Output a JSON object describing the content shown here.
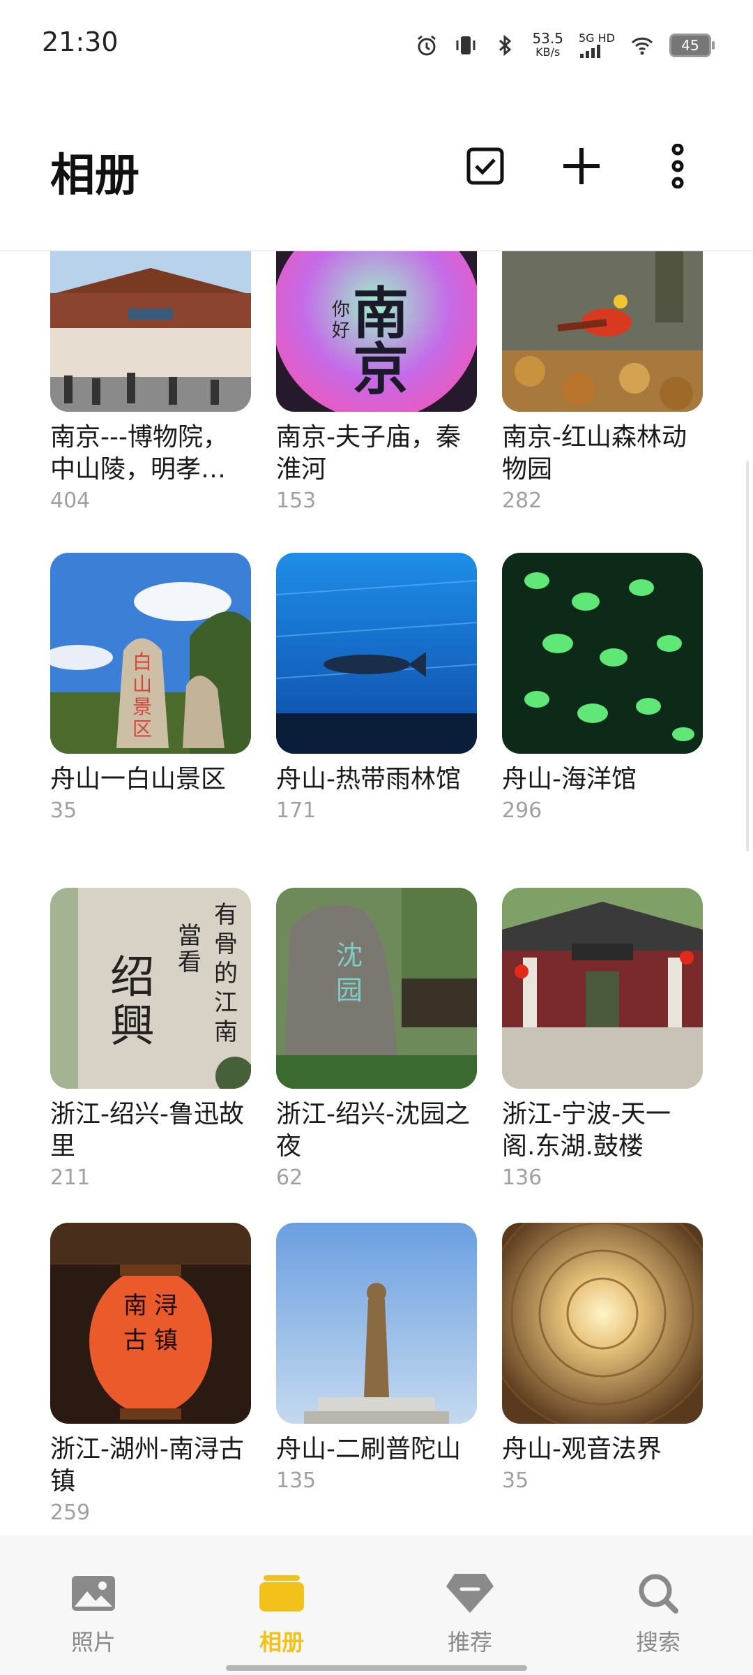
{
  "status_bar": {
    "time": "21:30",
    "net_speed_value": "53.5",
    "net_speed_unit": "KB/s",
    "network_label": "5G HD",
    "battery_level": "45",
    "icons": [
      "alarm-icon",
      "vibrate-icon",
      "bluetooth-icon",
      "signal-icon",
      "wifi-icon",
      "battery-icon"
    ]
  },
  "header": {
    "title": "相册",
    "actions": [
      "select-icon",
      "add-icon",
      "more-icon"
    ]
  },
  "albums": [
    {
      "name": "南京---博物院，中山陵，明孝…",
      "count": "404"
    },
    {
      "name": "南京-夫子庙，秦淮河",
      "count": "153",
      "thumb_text": [
        "你",
        "好",
        "南",
        "京"
      ]
    },
    {
      "name": "南京-红山森林动物园",
      "count": "282"
    },
    {
      "name": "舟山一白山景区",
      "count": "35",
      "thumb_text": [
        "白",
        "山",
        "景",
        "区"
      ]
    },
    {
      "name": "舟山-热带雨林馆",
      "count": "171"
    },
    {
      "name": "舟山-海洋馆",
      "count": "296"
    },
    {
      "name": "浙江-绍兴-鲁迅故里",
      "count": "211",
      "thumb_text": [
        "绍",
        "興",
        "當",
        "看",
        "有",
        "骨",
        "的",
        "江",
        "南"
      ]
    },
    {
      "name": "浙江-绍兴-沈园之夜",
      "count": "62",
      "thumb_text": [
        "沈",
        "园"
      ]
    },
    {
      "name": "浙江-宁波-天一阁.东湖.鼓楼",
      "count": "136"
    },
    {
      "name": "浙江-湖州-南浔古镇",
      "count": "259",
      "thumb_text": [
        "南",
        "浔",
        "古",
        "镇"
      ]
    },
    {
      "name": "舟山-二刷普陀山",
      "count": "135"
    },
    {
      "name": "舟山-观音法界",
      "count": "35"
    }
  ],
  "bottom_nav": {
    "items": [
      {
        "label": "照片",
        "icon": "photo-icon",
        "active": false
      },
      {
        "label": "相册",
        "icon": "album-icon",
        "active": true
      },
      {
        "label": "推荐",
        "icon": "diamond-icon",
        "active": false
      },
      {
        "label": "搜索",
        "icon": "search-icon",
        "active": false
      }
    ]
  },
  "colors": {
    "accent": "#f2c21a",
    "count_text": "#a0a0a0",
    "nav_inactive": "#8a8a8a"
  }
}
